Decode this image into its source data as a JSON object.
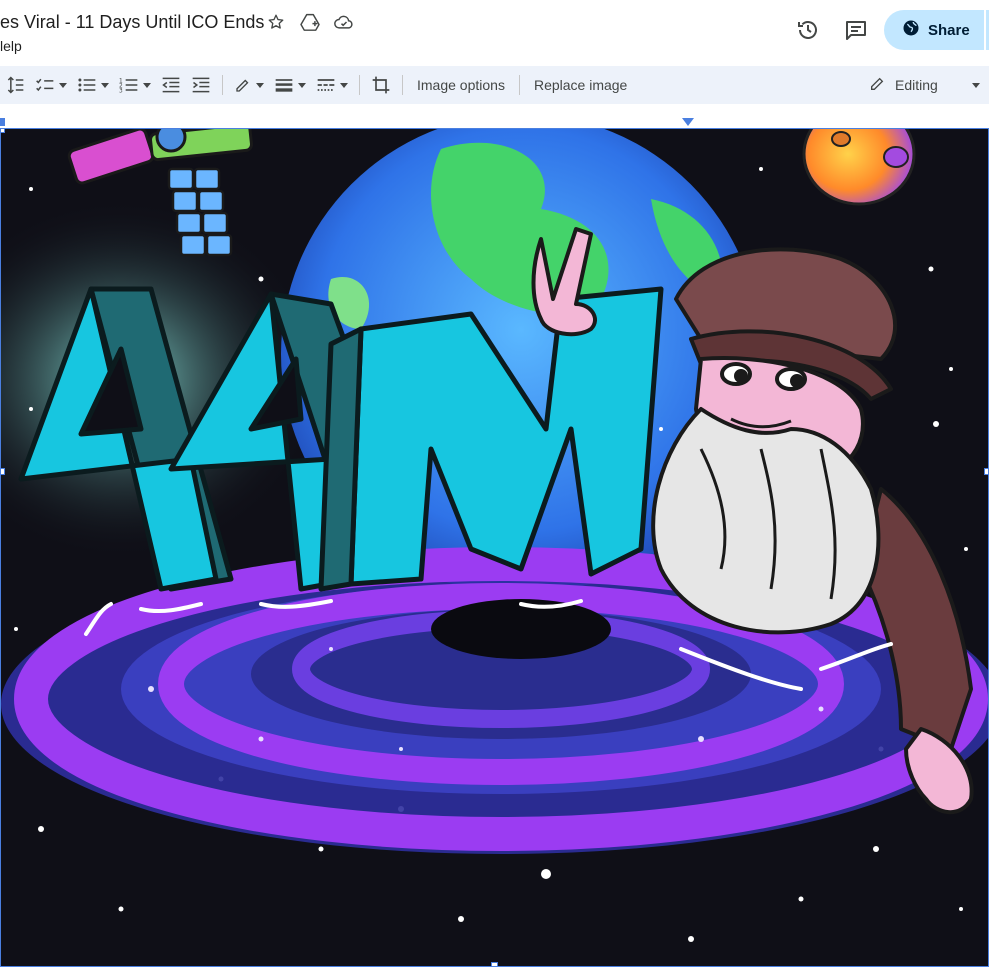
{
  "document": {
    "title": "es Viral - 11 Days Until ICO Ends",
    "menu_partial": "lelp"
  },
  "header": {
    "share_label": "Share",
    "icons": [
      "star-icon",
      "move-to-drive-icon",
      "cloud-status-icon",
      "version-history-icon",
      "comments-icon",
      "globe-icon"
    ]
  },
  "toolbar": {
    "image_options_label": "Image options",
    "replace_image_label": "Replace image",
    "mode_label": "Editing"
  },
  "illustration": {
    "big_text": "44M",
    "colors": {
      "space": "#0f0f17",
      "letters": "#17c6e0",
      "letters_shadow": "#1f6a73",
      "earth_ocean": "#3da8ff",
      "earth_land": "#44d36a",
      "swirl_purple": "#9b3cf2",
      "swirl_blue": "#3a3fbf",
      "hat": "#7a4a4c",
      "skin": "#f3b7d6",
      "beard": "#e6e6e6"
    }
  }
}
